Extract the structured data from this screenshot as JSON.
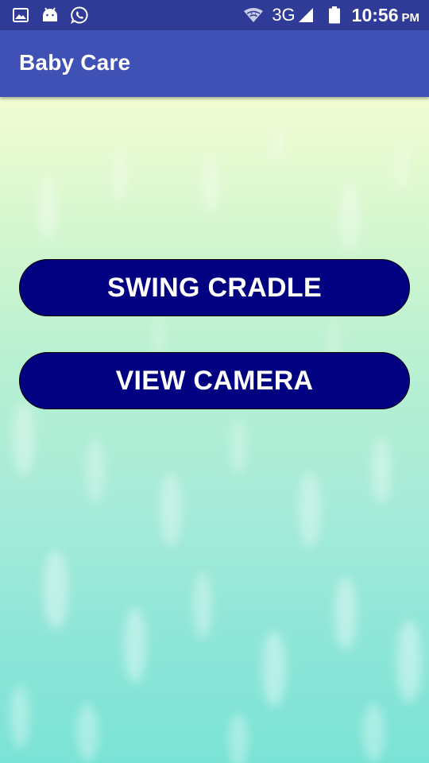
{
  "status_bar": {
    "left_icons": [
      "gallery-icon",
      "android-icon",
      "whatsapp-icon"
    ],
    "right_icons": [
      "wifi-hotspot-icon",
      "signal-icon",
      "battery-icon"
    ],
    "network": "3G",
    "time": "10:56",
    "ampm": "PM"
  },
  "app_bar": {
    "title": "Baby Care"
  },
  "main": {
    "swing_label": "SWING CRADLE",
    "camera_label": "VIEW CAMERA"
  },
  "colors": {
    "status_bar": "#2f3b97",
    "app_bar": "#3f51b5",
    "button": "#000080",
    "background_top": "#f2fcd2",
    "background_bottom": "#7ae3d6"
  }
}
